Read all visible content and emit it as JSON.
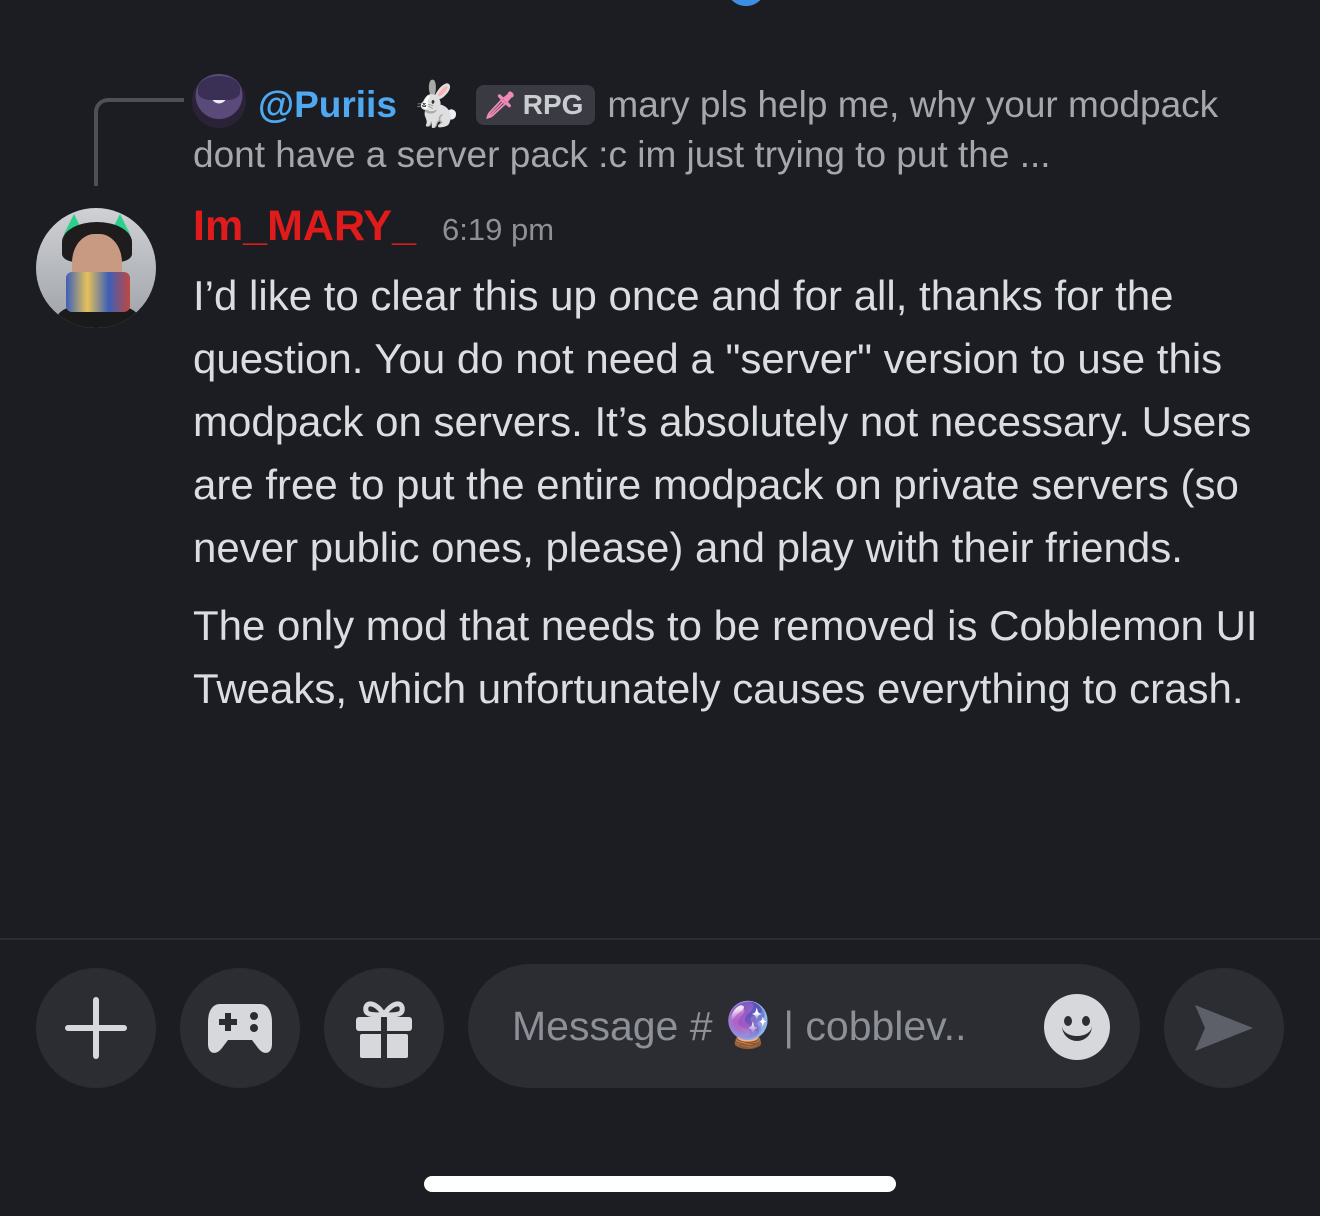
{
  "reply": {
    "username": "@Puriis",
    "emoji": "🐇",
    "role_icon": "🗡",
    "role_tag": "RPG",
    "preview_line1": "mary pls help me, why your modpack",
    "preview_line2": "dont have a server pack :c im just trying to put the ..."
  },
  "message": {
    "author": "Im_MARY_",
    "timestamp": "6:19 pm",
    "paragraph1": "I’d like to clear this up once and for all, thanks for the question. You do not need a \"server\" version to use this modpack on servers. It’s absolutely not necessary. Users are free to put the entire modpack on private servers (so never public ones, please) and play with their friends.",
    "paragraph2": "The only mod that needs to be removed is Cobblemon UI Tweaks, which unfortunately causes everything to crash."
  },
  "composer": {
    "placeholder_prefix": "Message #",
    "placeholder_emoji": "🔮",
    "placeholder_suffix": "| cobblev.."
  },
  "icons": {
    "add": "plus-icon",
    "activities": "gamepad-icon",
    "gift": "gift-icon",
    "emoji": "smiley-icon",
    "send": "send-icon"
  },
  "colors": {
    "background": "#1c1d22",
    "reply_name": "#4fa9f0",
    "author_name": "#e01b1b",
    "button_bg": "#2b2d33"
  }
}
